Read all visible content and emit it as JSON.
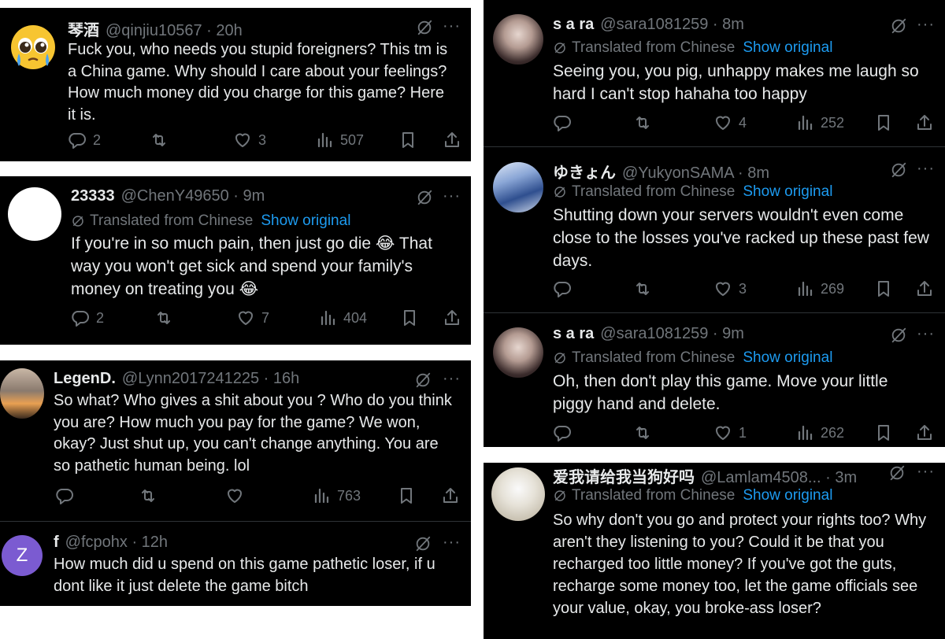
{
  "colors": {
    "background": "#000000",
    "text": "#e7e9ea",
    "muted": "#71767b",
    "link": "#1d9bf0",
    "separator": "#ffffff"
  },
  "icons": {
    "reply": "reply-icon",
    "retweet": "retweet-icon",
    "like": "heart-icon",
    "views": "views-icon",
    "bookmark": "bookmark-icon",
    "share": "share-icon",
    "grok": "grok-icon",
    "more": "more-icon"
  },
  "more_label": "···",
  "translated_label": "Translated from Chinese",
  "show_original_label": "Show original",
  "left": {
    "t1": {
      "name": "琴酒",
      "handle": "@qinjiu10567 · 20h",
      "text": "Fuck you, who needs you stupid foreigners? This tm is a China game. Why should I care about your feelings? How much money did you charge for this game? Here it is.",
      "replies": "2",
      "likes": "3",
      "views": "507"
    },
    "t2": {
      "name": "23333",
      "handle": "@ChenY49650 · 9m",
      "text": "If you're in so much pain, then just go die 😂 That way you won't get sick and spend your family's money on treating you 😂",
      "replies": "2",
      "likes": "7",
      "views": "404"
    },
    "t3": {
      "name": "LegenD.",
      "handle": "@Lynn2017241225 · 16h",
      "text": "So what? Who gives a shit about you ? Who do you think you are? How much you pay for the game? We won, okay? Just shut up, you can't change anything. You are so pathetic human being. lol",
      "views": "763"
    },
    "t4": {
      "name": "f",
      "handle": "@fcpohx · 12h",
      "avatar_letter": "Z",
      "text": "How much did u spend on this game pathetic loser, if u dont like it just delete the game bitch"
    }
  },
  "right": {
    "t1": {
      "name": "s a ra",
      "handle": "@sara1081259 · 8m",
      "text": "Seeing you, you pig, unhappy makes me laugh so hard I can't stop hahaha too happy",
      "likes": "4",
      "views": "252"
    },
    "t2": {
      "name": "ゆきょん",
      "handle": "@YukyonSAMA · 8m",
      "text": "Shutting down your servers wouldn't even come close to the losses you've racked up these past few days.",
      "likes": "3",
      "views": "269"
    },
    "t3": {
      "name": "s a ra",
      "handle": "@sara1081259 · 9m",
      "text": "Oh, then don't play this game. Move your little piggy hand and delete.",
      "likes": "1",
      "views": "262"
    },
    "t4": {
      "name": "爱我请给我当狗好吗",
      "handle": "@Lamlam4508... · 3m",
      "text": "So why don't you go and protect your rights too? Why aren't they listening to you? Could it be that you recharged too little money? If you've got the guts, recharge some money too, let the game officials see your value, okay, you broke-ass loser?"
    }
  }
}
